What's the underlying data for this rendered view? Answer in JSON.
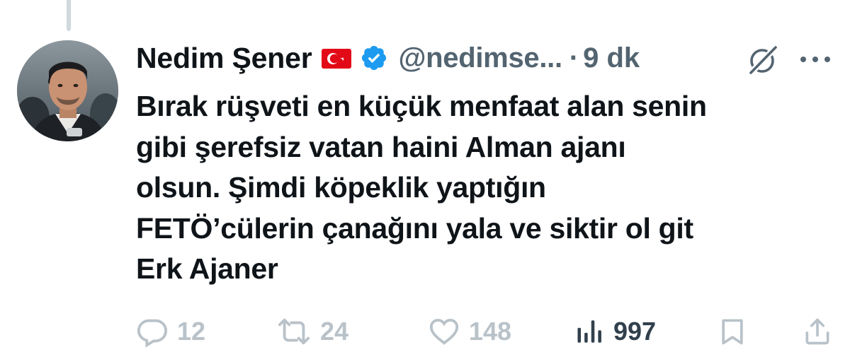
{
  "author": {
    "name": "Nedim Şener",
    "flag_icon": "turkey-flag-icon",
    "verified_icon": "verified-badge-icon",
    "handle": "@nedimse...",
    "separator": "·",
    "time": "9 dk"
  },
  "header_icons": {
    "grok": "grok-icon",
    "more": "more-options-icon"
  },
  "tweet": {
    "lines": [
      "Bırak rüşveti en küçük menfaat alan senin",
      "gibi şerefsiz vatan haini Alman ajanı",
      "olsun. Şimdi köpeklik yaptığın",
      "FETÖ’cülerin çanağını yala ve siktir ol git",
      "Erk Ajaner"
    ]
  },
  "actions": {
    "replies": "12",
    "retweets": "24",
    "likes": "148",
    "views": "997"
  },
  "colors": {
    "text": "#0f1419",
    "secondary": "#536471",
    "verified": "#1d9bf0",
    "flag": "#e30a17",
    "action_faded": "#b9c2c9",
    "thread_line": "#cfd9de"
  }
}
